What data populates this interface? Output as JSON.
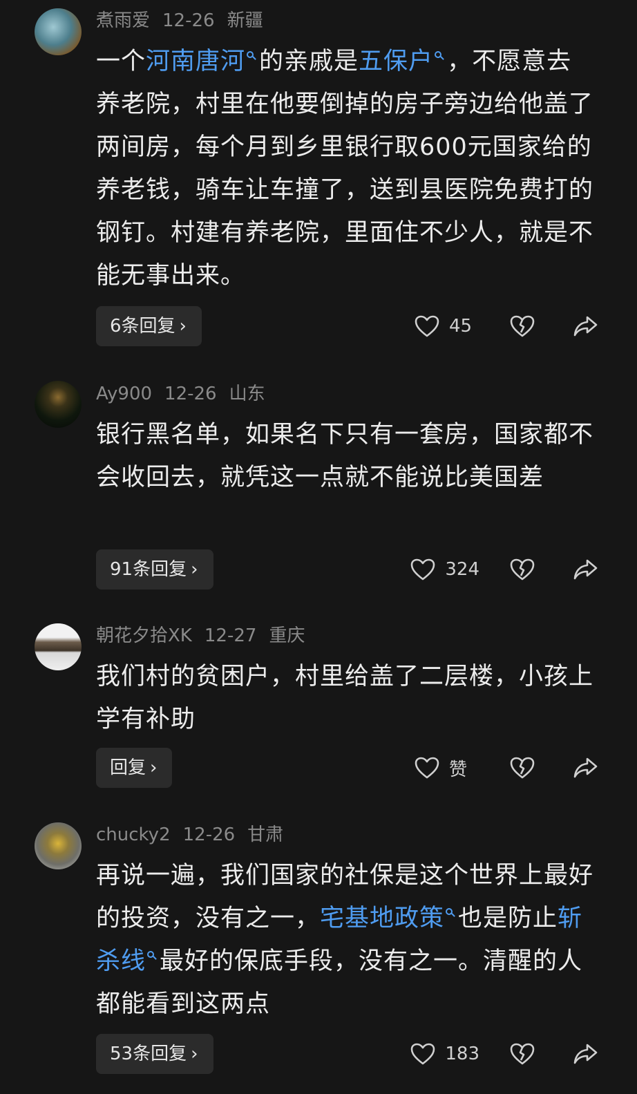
{
  "comments": [
    {
      "username": "煮雨爱",
      "date": "12-26",
      "location": "新疆",
      "text": {
        "p1": "一个",
        "link1": "河南唐河",
        "p2": "的亲戚是",
        "link2": "五保户",
        "p3": "，不愿意去养老院，村里在他要倒掉的房子旁边给他盖了两间房，每个月到乡里银行取600元国家给的养老钱，骑车让车撞了，送到县医院免费打的钢钉。村建有养老院，里面住不少人，就是不能无事出来。"
      },
      "reply_label": "6条回复",
      "like_count": "45"
    },
    {
      "username": "Ay900",
      "date": "12-26",
      "location": "山东",
      "text": {
        "p1": "银行黑名单，如果名下只有一套房，国家都不会收回去，就凭这一点就不能说比美国差"
      },
      "reply_label": "91条回复",
      "like_count": "324"
    },
    {
      "username": "朝花夕拾XK",
      "date": "12-27",
      "location": "重庆",
      "text": {
        "p1": "我们村的贫困户，村里给盖了二层楼，小孩上学有补助"
      },
      "reply_label": "回复",
      "like_count": "赞"
    },
    {
      "username": "chucky2",
      "date": "12-26",
      "location": "甘肃",
      "text": {
        "p1": "再说一遍，我们国家的社保是这个世界上最好的投资，没有之一，",
        "link1": "宅基地政策",
        "p2": "也是防止",
        "link2": "斩杀线",
        "p3": "最好的保底手段，没有之一。清醒的人都能看到这两点"
      },
      "reply_label": "53条回复",
      "like_count": "183"
    }
  ],
  "icons": {
    "like": "heart-outline-icon",
    "dislike": "broken-heart-icon",
    "share": "share-arrow-icon",
    "search_link": "search-icon"
  },
  "colors": {
    "background": "#161616",
    "link": "#4f9cf0",
    "meta": "#8a8a8a",
    "reply_button": "#2b2b2b"
  }
}
